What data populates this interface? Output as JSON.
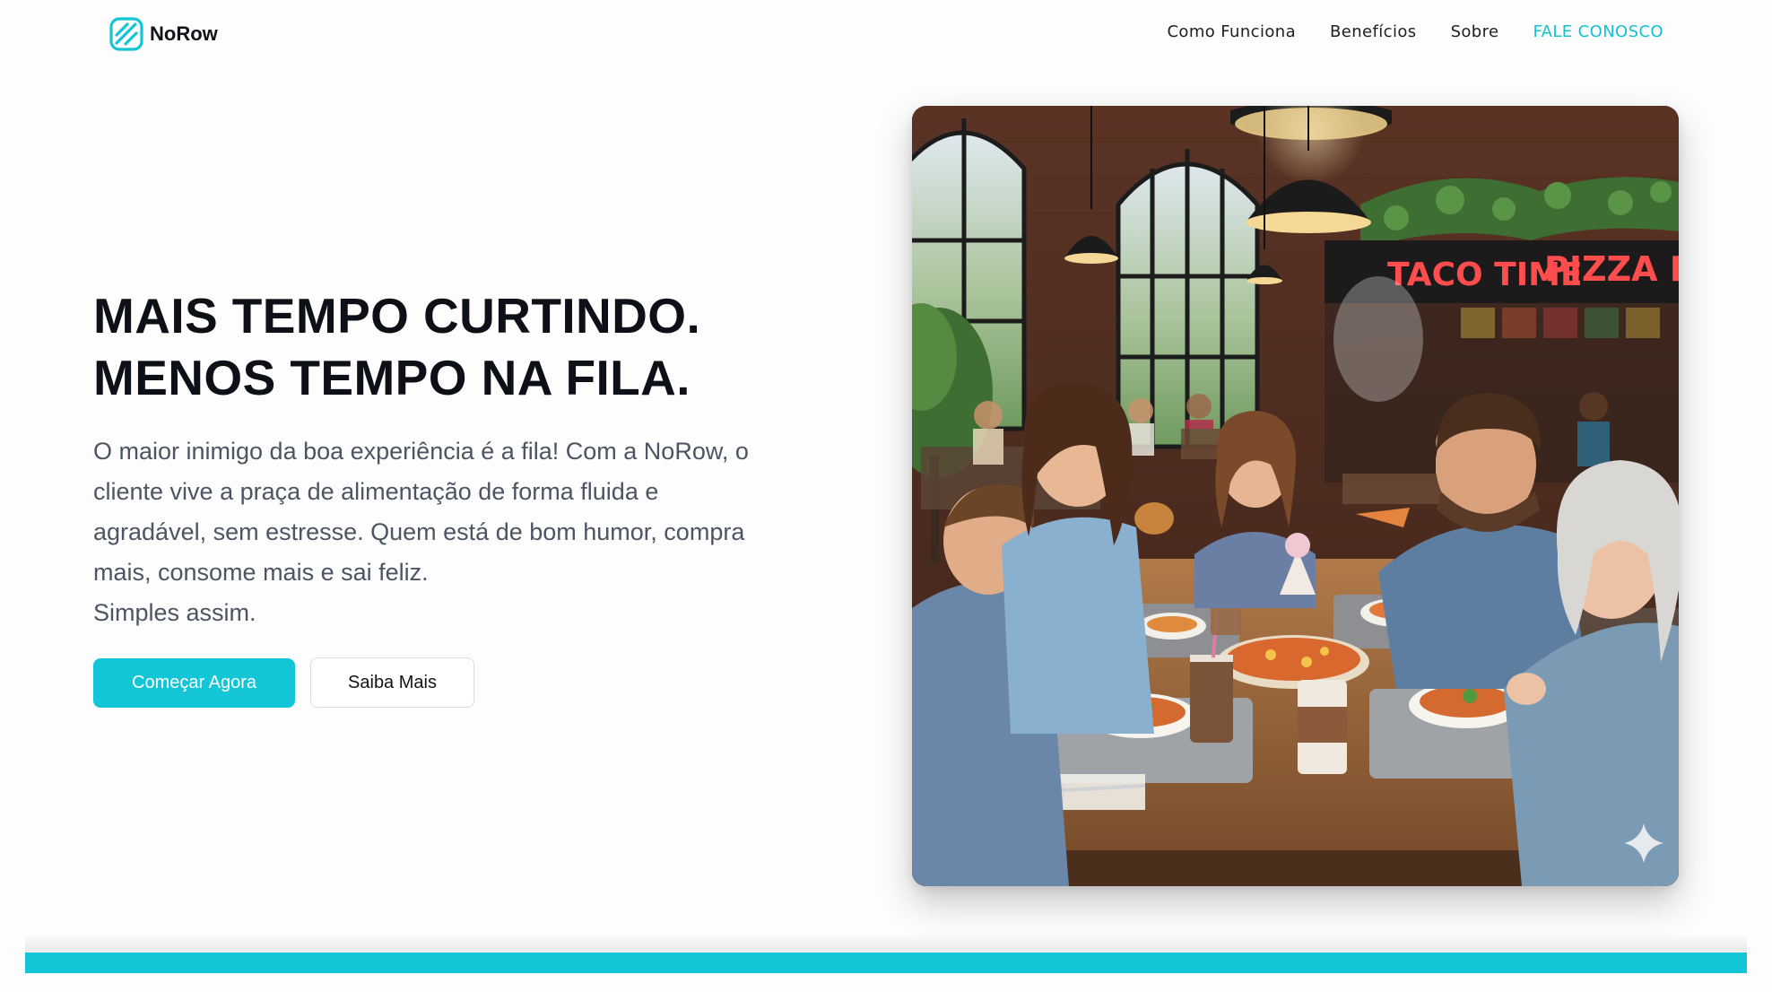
{
  "brand": {
    "name": "NoRow",
    "accent_color": "#12c6d8",
    "logo_icon": "norow-logo-icon"
  },
  "nav": {
    "items": [
      {
        "label": "Como Funciona"
      },
      {
        "label": "Benefícios"
      },
      {
        "label": "Sobre"
      }
    ],
    "cta_label": "FALE CONOSCO"
  },
  "hero": {
    "headline_lines": [
      "MAIS TEMPO CURTINDO.",
      "MENOS TEMPO NA FILA."
    ],
    "lead_lines": [
      "O maior inimigo da boa experiência é a fila! Com a NoRow, o",
      "cliente vive a praça de alimentação de forma fluida e",
      "agradável, sem estresse. Quem está de bom humor, compra",
      "mais, consome mais e sai feliz.",
      "Simples assim."
    ],
    "primary_button": "Começar Agora",
    "secondary_button": "Saiba Mais",
    "image": {
      "signs": [
        "TACO TIME",
        "PIZZA PAL"
      ],
      "sparkle_icon": "sparkle-icon"
    }
  }
}
